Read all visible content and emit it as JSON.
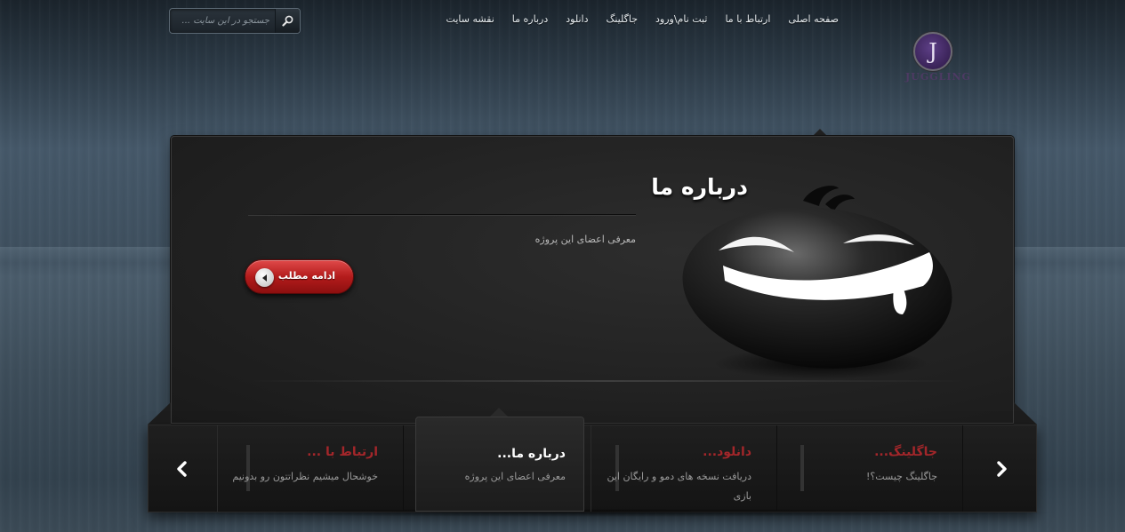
{
  "search": {
    "placeholder": "جستجو در این سایت ..."
  },
  "nav": {
    "items": [
      "صفحه اصلی",
      "ارتباط با ما",
      "ثبت نام\\ورود",
      "جاگلینگ",
      "دانلود",
      "درباره ما",
      "نقشه سایت"
    ]
  },
  "logo": {
    "letter": "J",
    "word": "JUGGLING"
  },
  "slide": {
    "title": "درباره ما",
    "description": "معرفی اعضای این پروژه",
    "more_button": "ادامه مطلب"
  },
  "carousel": {
    "items": [
      {
        "title": "جاگلینگ...",
        "description": "جاگلینگ چیست؟!"
      },
      {
        "title": "دانلود...",
        "description": "دریافت نسخه های دمو و رایگان این بازی"
      },
      {
        "title": "درباره ما...",
        "description": "معرفی اعضای این پروژه"
      },
      {
        "title": "ارتباط با ...",
        "description": "خوشحال میشیم نظراتتون رو بدونیم"
      }
    ],
    "active_index": 2
  },
  "colors": {
    "accent_red": "#a3262a",
    "button_red": "#b41c1c",
    "logo_purple": "#5d3f86"
  }
}
